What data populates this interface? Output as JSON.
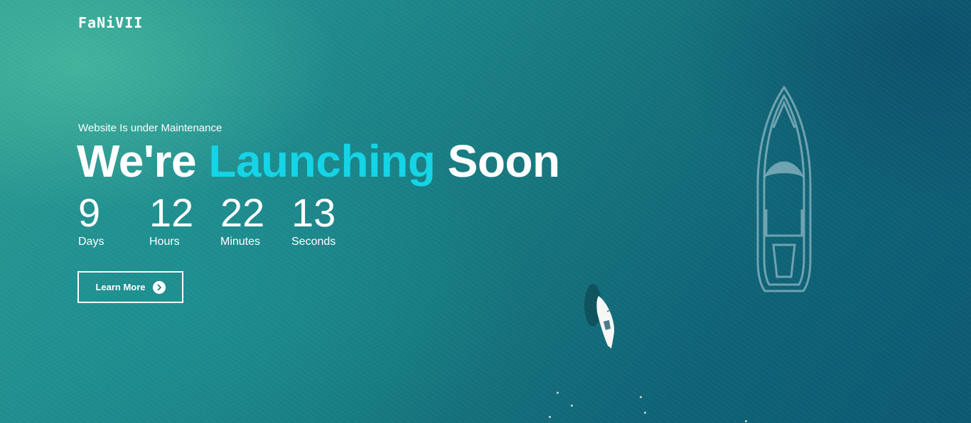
{
  "logo": {
    "text": "FaNiVII"
  },
  "hero": {
    "subtitle": "Website Is under Maintenance",
    "headline_part1": "We're ",
    "headline_accent": "Launching",
    "headline_part2": " Soon"
  },
  "countdown": [
    {
      "value": "9",
      "label": "Days"
    },
    {
      "value": "12",
      "label": "Hours"
    },
    {
      "value": "22",
      "label": "Minutes"
    },
    {
      "value": "13",
      "label": "Seconds"
    }
  ],
  "cta": {
    "label": "Learn More",
    "icon": "chevron-right-icon"
  },
  "decorations": {
    "outline": "boat-outline-icon",
    "photo": "boat-icon"
  },
  "colors": {
    "accent": "#15d4e6",
    "text": "#ffffff",
    "sea_light": "#2f9e93",
    "sea_dark": "#0c5a72"
  }
}
